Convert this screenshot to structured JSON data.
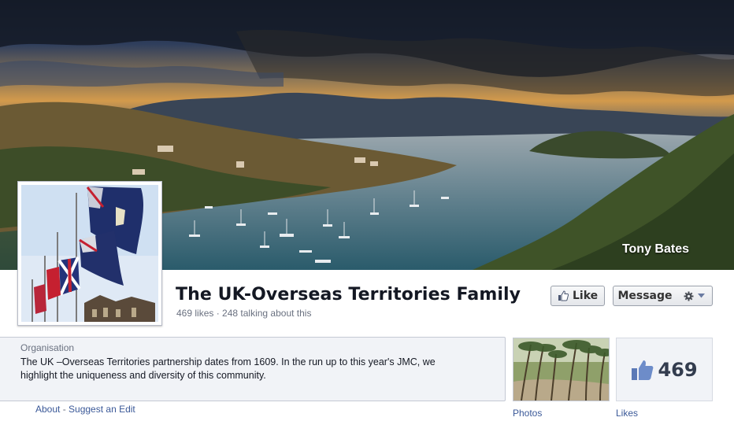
{
  "cover": {
    "photo_credit": "Tony Bates"
  },
  "page": {
    "name": "The UK-Overseas Territories Family",
    "likes_text": "469 likes",
    "talking_text": "248 talking about this",
    "separator": " · "
  },
  "actions": {
    "like_label": "Like",
    "message_label": "Message"
  },
  "about": {
    "category": "Organisation",
    "description": "The UK –Overseas Territories partnership dates from 1609. In the run up to this year's JMC, we highlight the uniqueness and diversity of this community.",
    "about_link": "About",
    "link_separator": " - ",
    "suggest_link": "Suggest an Edit"
  },
  "apps": {
    "photos_label": "Photos",
    "likes_label": "Likes",
    "likes_count": "469"
  },
  "colors": {
    "link": "#3b5998",
    "text": "#141823",
    "muted": "#6a7180"
  },
  "icons": [
    "thumbs-up-icon",
    "gear-icon",
    "caret-down-icon"
  ]
}
